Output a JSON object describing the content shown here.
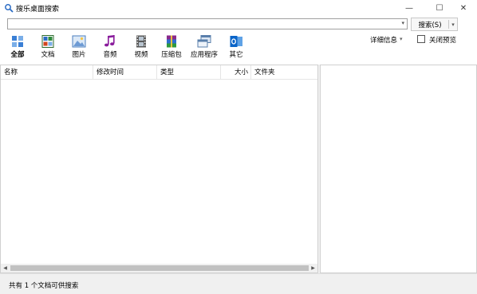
{
  "window": {
    "title": "搜乐桌面搜索",
    "controls": {
      "minimize": "—",
      "maximize": "☐",
      "close": "✕"
    }
  },
  "search": {
    "value": "",
    "button_label": "搜索(S)",
    "dropdown_glyph": "▾",
    "split_glyph": "▾"
  },
  "categories": [
    {
      "id": "all",
      "label": "全部",
      "icon": "all-grid-icon",
      "active": true
    },
    {
      "id": "docs",
      "label": "文档",
      "icon": "document-icon",
      "active": false
    },
    {
      "id": "images",
      "label": "图片",
      "icon": "picture-icon",
      "active": false
    },
    {
      "id": "music",
      "label": "音频",
      "icon": "music-note-icon",
      "active": false
    },
    {
      "id": "video",
      "label": "视频",
      "icon": "film-icon",
      "active": false
    },
    {
      "id": "archive",
      "label": "压缩包",
      "icon": "archive-icon",
      "active": false
    },
    {
      "id": "apps",
      "label": "应用程序",
      "icon": "application-icon",
      "active": false
    },
    {
      "id": "other",
      "label": "其它",
      "icon": "outlook-icon",
      "active": false
    }
  ],
  "view": {
    "detail_label": "详细信息",
    "detail_arrow": "▾",
    "preview_label": "关闭预览",
    "preview_checked": false
  },
  "columns": [
    "名称",
    "修改时间",
    "类型",
    "大小",
    "文件夹"
  ],
  "rows": [],
  "status": {
    "text": "共有 1 个文档可供搜索"
  },
  "colors": {
    "accent_blue": "#2b6cc4",
    "music_purple": "#8a1c9c",
    "outlook_blue": "#0a64c8"
  }
}
